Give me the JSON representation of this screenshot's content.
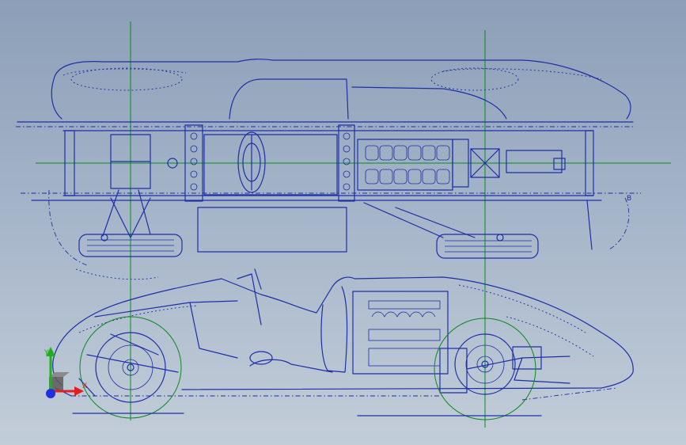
{
  "viewport": {
    "background_top": "#8c9fb8",
    "background_bottom": "#c2cdd8",
    "sketch_color": "#1e2ea8",
    "guide_color": "#0a8a1e"
  },
  "triad": {
    "x_label": "X",
    "y_label": "Y",
    "x_color": "#e02020",
    "y_color": "#20b020",
    "z_color": "#2030e0",
    "origin_icon": "view-origin-icon"
  },
  "side_marker": "B"
}
